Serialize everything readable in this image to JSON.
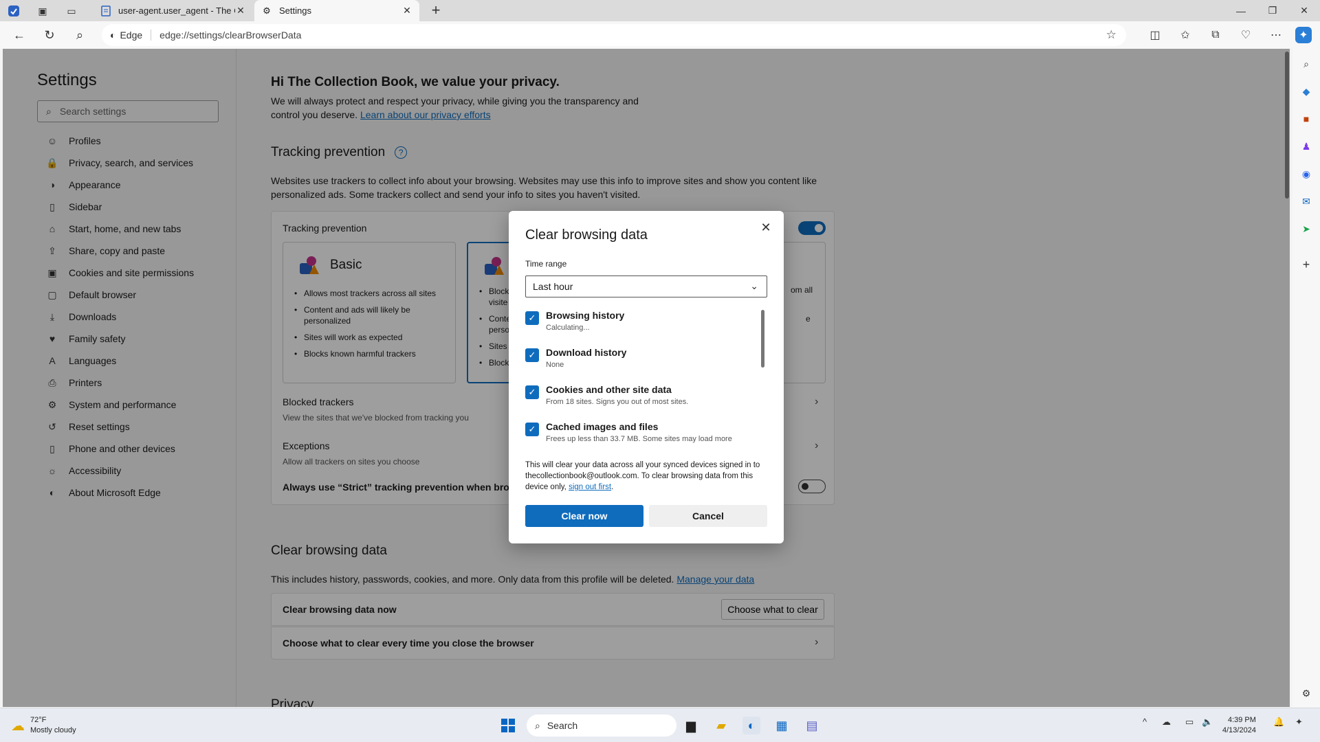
{
  "browser": {
    "tabs": [
      {
        "label": "user-agent.user_agent - The Coll",
        "favicon": "document-icon"
      },
      {
        "label": "Settings",
        "favicon": "gear-icon"
      }
    ],
    "identity_label": "Edge",
    "url": "edge://settings/clearBrowserData"
  },
  "sidebar": {
    "title": "Settings",
    "search_placeholder": "Search settings",
    "items": [
      {
        "label": "Profiles",
        "icon": "person-icon"
      },
      {
        "label": "Privacy, search, and services",
        "icon": "lock-icon"
      },
      {
        "label": "Appearance",
        "icon": "palette-icon"
      },
      {
        "label": "Sidebar",
        "icon": "sidebar-icon"
      },
      {
        "label": "Start, home, and new tabs",
        "icon": "home-icon"
      },
      {
        "label": "Share, copy and paste",
        "icon": "share-icon"
      },
      {
        "label": "Cookies and site permissions",
        "icon": "cookie-icon"
      },
      {
        "label": "Default browser",
        "icon": "browser-icon"
      },
      {
        "label": "Downloads",
        "icon": "download-icon"
      },
      {
        "label": "Family safety",
        "icon": "family-icon"
      },
      {
        "label": "Languages",
        "icon": "language-icon"
      },
      {
        "label": "Printers",
        "icon": "printer-icon"
      },
      {
        "label": "System and performance",
        "icon": "system-icon"
      },
      {
        "label": "Reset settings",
        "icon": "reset-icon"
      },
      {
        "label": "Phone and other devices",
        "icon": "phone-icon"
      },
      {
        "label": "Accessibility",
        "icon": "accessibility-icon"
      },
      {
        "label": "About Microsoft Edge",
        "icon": "edge-icon"
      }
    ]
  },
  "main": {
    "greeting": "Hi The Collection Book, we value your privacy.",
    "privacy_desc": "We will always protect and respect your privacy, while giving you the transparency and control you deserve.",
    "privacy_link": "Learn about our privacy efforts",
    "tracking": {
      "section_title": "Tracking prevention",
      "desc": "Websites use trackers to collect info about your browsing. Websites may use this info to improve sites and show you content like personalized ads. Some trackers collect and send your info to sites you haven't visited.",
      "card_title": "Tracking prevention",
      "enabled": true,
      "basic": {
        "title": "Basic",
        "bullets": [
          "Allows most trackers across all sites",
          "Content and ads will likely be personalized",
          "Sites will work as expected",
          "Blocks known harmful trackers"
        ]
      },
      "balanced": {
        "fragments": [
          "Block",
          "visite",
          "Conte",
          "perso",
          "Sites w",
          "Block"
        ]
      },
      "strict": {
        "fragments": [
          "om all",
          "e"
        ]
      },
      "blocked_title": "Blocked trackers",
      "blocked_sub": "View the sites that we've blocked from tracking you",
      "exceptions_title": "Exceptions",
      "exceptions_sub": "Allow all trackers on sites you choose",
      "always_strict": "Always use “Strict” tracking prevention when browsi"
    },
    "clear": {
      "section_title": "Clear browsing data",
      "desc": "This includes history, passwords, cookies, and more. Only data from this profile will be deleted.",
      "manage_link": "Manage your data",
      "now_label": "Clear browsing data now",
      "choose_button": "Choose what to clear",
      "on_close_label": "Choose what to clear every time you close the browser"
    },
    "next_section_partial": "Privacy"
  },
  "dialog": {
    "title": "Clear browsing data",
    "time_range_label": "Time range",
    "time_range_value": "Last hour",
    "options": [
      {
        "title": "Browsing history",
        "sub": "Calculating...",
        "checked": true
      },
      {
        "title": "Download history",
        "sub": "None",
        "checked": true
      },
      {
        "title": "Cookies and other site data",
        "sub": "From 18 sites. Signs you out of most sites.",
        "checked": true
      },
      {
        "title": "Cached images and files",
        "sub": "Frees up less than 33.7 MB. Some sites may load more",
        "checked": true
      }
    ],
    "sync_note": "This will clear your data across all your synced devices signed in to thecollectionbook@outlook.com. To clear browsing data from this device only,",
    "sync_link": "sign out first",
    "sync_end": ".",
    "clear_button": "Clear now",
    "cancel_button": "Cancel"
  },
  "taskbar": {
    "weather_temp": "72°F",
    "weather_desc": "Mostly cloudy",
    "search_label": "Search",
    "time": "4:39 PM",
    "date": "4/13/2024"
  },
  "colors": {
    "accent": "#0f6cbd",
    "overlay": "rgba(0,0,0,0.38)"
  }
}
